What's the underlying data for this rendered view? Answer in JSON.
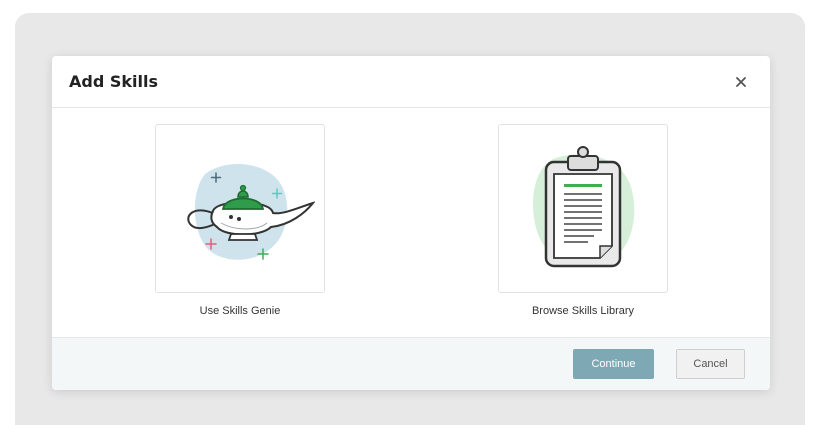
{
  "modal": {
    "title": "Add Skills",
    "close_icon": "close-icon"
  },
  "options": [
    {
      "label": "Use Skills Genie",
      "icon": "genie-lamp-icon"
    },
    {
      "label": "Browse Skills Library",
      "icon": "clipboard-icon"
    }
  ],
  "footer": {
    "continue_label": "Continue",
    "cancel_label": "Cancel"
  },
  "colors": {
    "continue_bg": "#7ea9b4",
    "lamp_lid": "#2e9c4a",
    "accent_green": "#3fae4f",
    "blob_blue": "#cfe3ec",
    "blob_green": "#d6efd9"
  }
}
